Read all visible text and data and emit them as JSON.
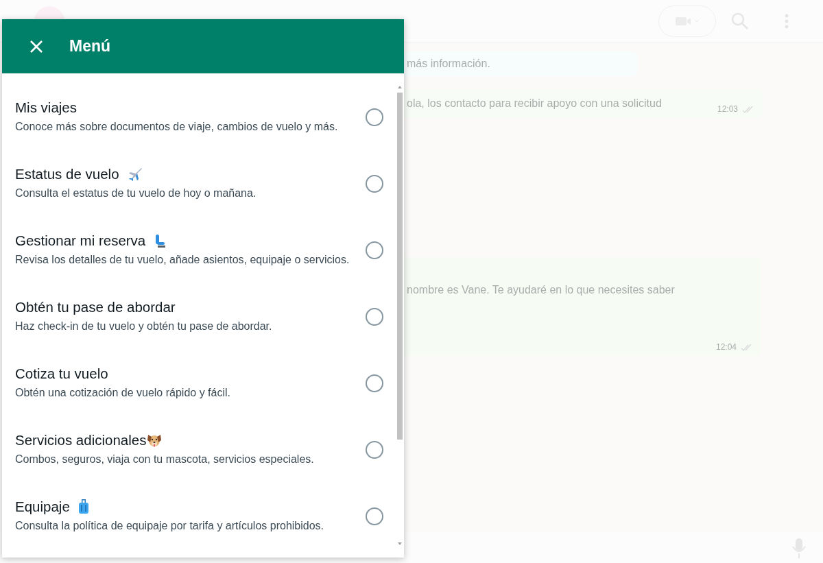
{
  "background_chat": {
    "messages": [
      {
        "text": "más información.",
        "kind": "info"
      },
      {
        "text": "ola, los contacto para recibir apoyo con una solicitud",
        "time": "12:03",
        "kind": "sent"
      },
      {
        "text": "nombre es Vane. Te ayudaré en lo que necesites saber",
        "time": "12:04",
        "kind": "sent_tall"
      }
    ]
  },
  "menu": {
    "title": "Menú",
    "items": [
      {
        "title": "Mis viajes",
        "description": "Conoce más sobre documentos de viaje, cambios de vuelo y más.",
        "selected": false
      },
      {
        "title": "Estatus de vuelo",
        "description": "Consulta el estatus de tu vuelo de hoy o mañana.",
        "selected": false
      },
      {
        "title": "Gestionar mi reserva",
        "description": "Revisa los detalles de tu vuelo, añade asientos, equipaje o servicios.",
        "selected": false
      },
      {
        "title": "Obtén tu pase de abordar",
        "description": "Haz check-in de tu vuelo y obtén tu pase de abordar.",
        "selected": false
      },
      {
        "title": "Cotiza tu vuelo",
        "description": "Obtén una cotización de vuelo rápido y fácil.",
        "selected": false
      },
      {
        "title": "Servicios adicionales",
        "description": "Combos, seguros, viaja con tu mascota, servicios especiales.",
        "selected": false
      },
      {
        "title": "Equipaje",
        "description": "Consulta la política de equipaje por tarifa y artículos prohibidos.",
        "selected": false
      }
    ]
  }
}
